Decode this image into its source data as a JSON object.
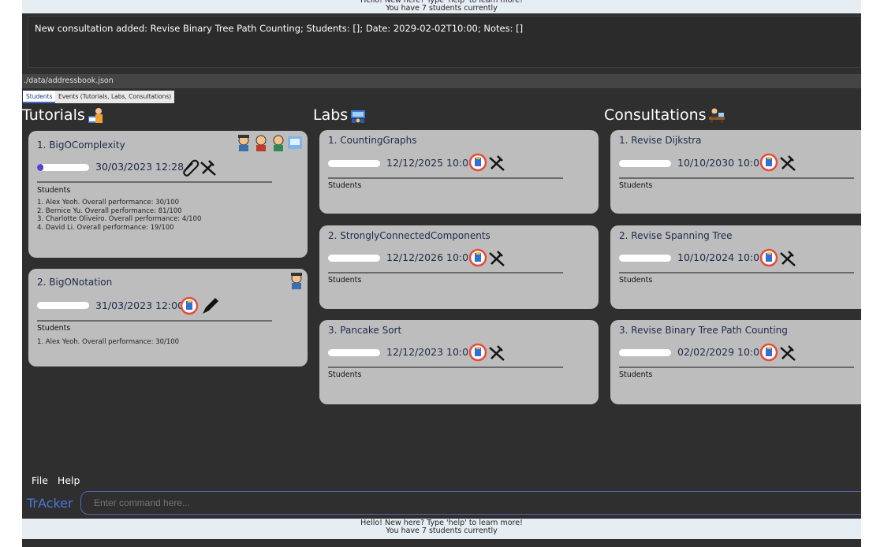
{
  "greeting": {
    "line1": "Hello! New here? Type 'help' to learn more!",
    "line2": "You have 7 students currently"
  },
  "result_text": "New consultation added: Revise Binary Tree Path Counting; Students: []; Date: 2029-02-02T10:00; Notes: []",
  "file_path": "./data/addressbook.json",
  "tabs": [
    {
      "label": "Students",
      "active": true
    },
    {
      "label": "Events (Tutorials, Labs, Consultations)",
      "active": false
    }
  ],
  "columns": {
    "tutorials": {
      "title": "Tutorials",
      "cards": [
        {
          "title": "1.  BigOComplexity",
          "date": "30/03/2023 12:28",
          "progress": 0.12,
          "students_label": "Students",
          "students": [
            "1. Alex Yeoh. Overall performance: 30/100",
            "2. Bernice Yu. Overall performance: 81/100",
            "3. Charlotte Oliveiro. Overall performance: 4/100",
            "4. David Li. Overall performance: 19/100"
          ]
        },
        {
          "title": "2.  BigONotation",
          "date": "31/03/2023 12:00",
          "progress": 0,
          "students_label": "Students",
          "students": [
            "1. Alex Yeoh. Overall performance: 30/100"
          ]
        }
      ]
    },
    "labs": {
      "title": "Labs",
      "cards": [
        {
          "title": "1.  CountingGraphs",
          "date": "12/12/2025 10:00",
          "progress": 0,
          "students_label": "Students"
        },
        {
          "title": "2.  StronglyConnectedComponents",
          "date": "12/12/2026 10:00",
          "progress": 0,
          "students_label": "Students"
        },
        {
          "title": "3.  Pancake Sort",
          "date": "12/12/2023 10:00",
          "progress": 0,
          "students_label": "Students"
        }
      ]
    },
    "consultations": {
      "title": "Consultations",
      "cards": [
        {
          "title": "1.  Revise Dijkstra",
          "date": "10/10/2030 10:00",
          "progress": 0,
          "students_label": "Students"
        },
        {
          "title": "2.  Revise Spanning Tree",
          "date": "10/10/2024 10:00",
          "progress": 0,
          "students_label": "Students"
        },
        {
          "title": "3.  Revise Binary Tree Path Counting",
          "date": "02/02/2029 10:00",
          "progress": 0,
          "students_label": "Students"
        }
      ]
    }
  },
  "menu": {
    "file": "File",
    "help": "Help"
  },
  "brand": "TrAcker",
  "command": {
    "placeholder": "Enter command here...",
    "value": ""
  },
  "colors": {
    "background": "#2f2f2f",
    "card": "#bdbdbd",
    "progress_fill": "#5a3fd6",
    "brand": "#4a78d6"
  }
}
